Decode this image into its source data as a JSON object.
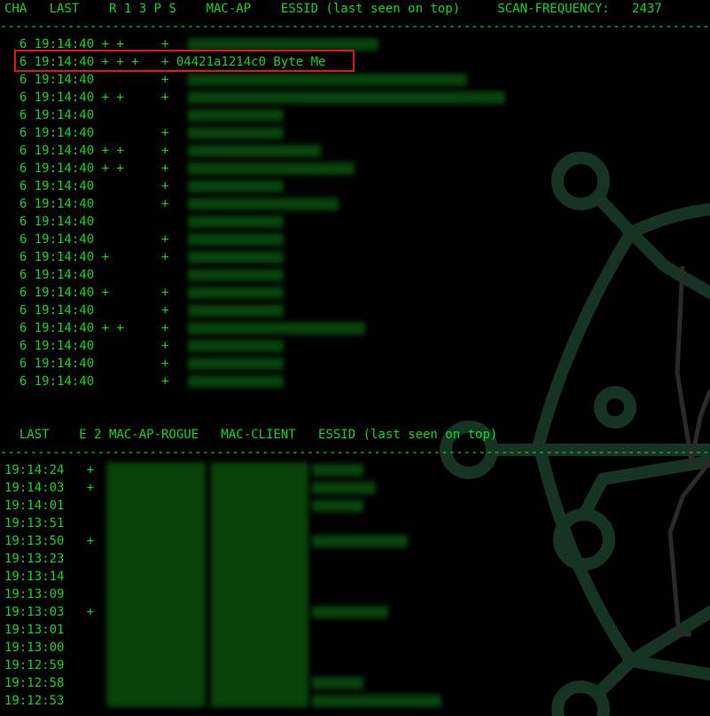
{
  "colors": {
    "background": "#000000",
    "text": "#13d51f",
    "highlight": "#e0141c",
    "logo": "#163324"
  },
  "ap_section": {
    "header": "CHA   LAST    R 1 3 P S    MAC-AP    ESSID (last seen on top)     SCAN-FREQUENCY:   2437",
    "separator": "-----------------------------------------------------------------------------------------------",
    "rows": [
      "  6 19:14:40 + +     +",
      "  6 19:14:40 + + +   + 04421a1214c0 Byte Me",
      "  6 19:14:40         +",
      "  6 19:14:40 + +     +",
      "  6 19:14:40",
      "  6 19:14:40         +",
      "  6 19:14:40 + +     +",
      "  6 19:14:40 + +     +",
      "  6 19:14:40         +",
      "  6 19:14:40         +",
      "  6 19:14:40",
      "  6 19:14:40         +",
      "  6 19:14:40 +       +",
      "  6 19:14:40",
      "  6 19:14:40 +       +",
      "  6 19:14:40         +",
      "  6 19:14:40 + +     +",
      "  6 19:14:40         +",
      "  6 19:14:40         +",
      "  6 19:14:40         +"
    ]
  },
  "client_section": {
    "header": "  LAST    E 2 MAC-AP-ROGUE   MAC-CLIENT   ESSID (last seen on top)",
    "separator": "-----------------------------------------------------------------------------------------------",
    "rows": [
      "19:14:24   +",
      "19:14:03   +",
      "19:14:01",
      "19:13:51",
      "19:13:50   +",
      "19:13:23",
      "19:13:14",
      "19:13:09",
      "19:13:03   +",
      "19:13:01",
      "19:13:00",
      "19:12:59",
      "19:12:58",
      "19:12:53"
    ]
  }
}
